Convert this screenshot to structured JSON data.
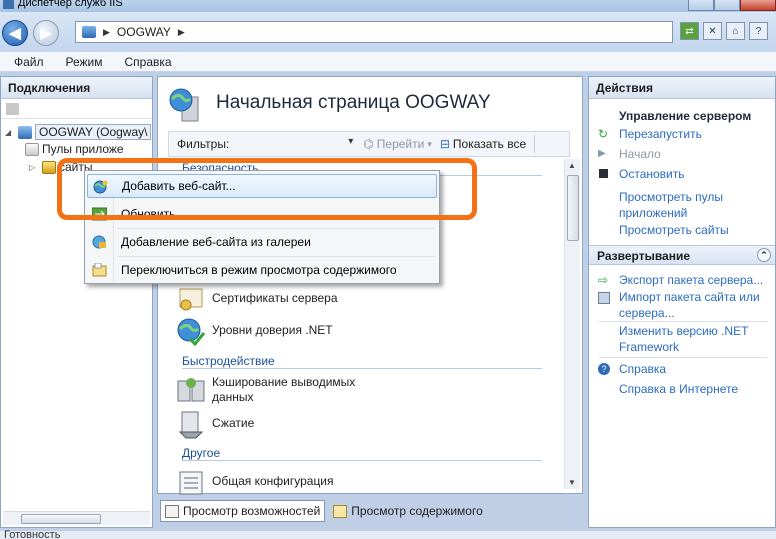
{
  "window": {
    "title": "Диспетчер служб IIS"
  },
  "address": {
    "segments": [
      "OOGWAY"
    ]
  },
  "menu": [
    "Файл",
    "Режим",
    "Справка"
  ],
  "connections": {
    "title": "Подключения",
    "server": "OOGWAY (Oogway\\",
    "pools": "Пулы приложе",
    "sites": "сайты"
  },
  "center": {
    "title": "Начальная страница OOGWAY",
    "filter_label": "Фильтры:",
    "go_label": "Перейти",
    "show_all_label": "Показать все",
    "groups": {
      "security": "Безопасность",
      "performance": "Быстродействие",
      "other": "Другое"
    },
    "features": {
      "certs": "Сертификаты сервера",
      "trust": "Уровни доверия .NET",
      "caching_1": "Кэширование выводимых",
      "caching_2": "данных",
      "compression": "Сжатие",
      "config": "Общая конфигурация"
    },
    "view_tabs": {
      "features": "Просмотр возможностей",
      "content": "Просмотр содержимого"
    }
  },
  "context_menu": {
    "items": [
      "Добавить веб-сайт...",
      "Обновить",
      "Добавление веб-сайта из галереи",
      "Переключиться в режим просмотра содержимого"
    ]
  },
  "actions": {
    "title": "Действия",
    "manage_header": "Управление сервером",
    "restart": "Перезапустить",
    "start": "Начало",
    "stop": "Остановить",
    "view_pools_1": "Просмотреть пулы",
    "view_pools_2": "приложений",
    "view_sites": "Просмотреть сайты",
    "deploy_header": "Развертывание",
    "export": "Экспорт пакета сервера...",
    "import_1": "Импорт пакета сайта или",
    "import_2": "сервера...",
    "change_net_1": "Изменить версию .NET",
    "change_net_2": "Framework",
    "help": "Справка",
    "help_online": "Справка в Интернете"
  },
  "status": "Готовность",
  "colors": {
    "highlight": "#f47216",
    "link": "#2b6cbf",
    "group": "#1c4f9c"
  }
}
